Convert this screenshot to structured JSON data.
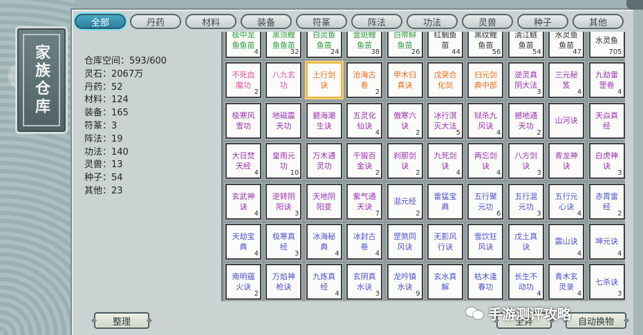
{
  "window": {
    "title": "家族仓库"
  },
  "tabs": [
    "全部",
    "丹药",
    "材料",
    "装备",
    "符篆",
    "阵法",
    "功法",
    "灵兽",
    "种子",
    "其他"
  ],
  "stats": [
    "仓库空间：593/600",
    "灵石：2067万",
    "丹药：52",
    "材料：124",
    "装备：165",
    "符篆：3",
    "阵法：19",
    "功法：140",
    "灵兽：13",
    "种子：54",
    "其他：23"
  ],
  "grid": {
    "rows": [
      [
        {
          "name": "极中龙鱼鱼苗",
          "count": "4",
          "quality": "green"
        },
        {
          "name": "黑须鲤鱼鱼苗",
          "count": "32",
          "quality": "green"
        },
        {
          "name": "白灵鱼鱼苗",
          "count": "24",
          "quality": "green"
        },
        {
          "name": "金斑鲤鱼苗",
          "count": "38",
          "quality": "green"
        },
        {
          "name": "白带鲟鱼苗",
          "count": "26",
          "quality": "green"
        },
        {
          "name": "红鲷鱼苗",
          "count": "44",
          "quality": "black"
        },
        {
          "name": "黑纹鲤鱼苗",
          "count": "56",
          "quality": "black"
        },
        {
          "name": "清江鲢鱼苗",
          "count": "54",
          "quality": "black"
        },
        {
          "name": "水灵鱼鱼苗",
          "count": "47",
          "quality": "black"
        },
        {
          "name": "水灵鱼",
          "count": "705",
          "quality": "black"
        }
      ],
      [
        {
          "name": "不死血魔功",
          "count": "2",
          "quality": "pink"
        },
        {
          "name": "八九玄功",
          "count": "",
          "quality": "pink"
        },
        {
          "name": "土行剑诀",
          "count": "",
          "quality": "orange"
        },
        {
          "name": "沧海古卷",
          "count": "2",
          "quality": "orange"
        },
        {
          "name": "甲木归真诀",
          "count": "",
          "quality": "orange"
        },
        {
          "name": "戊癸合化剑",
          "count": "",
          "quality": "orange"
        },
        {
          "name": "归元剑典中部",
          "count": "",
          "quality": "orange"
        },
        {
          "name": "逆灵真阴大法",
          "count": "3",
          "quality": "purple"
        },
        {
          "name": "三元秘笈",
          "count": "4",
          "quality": "purple"
        },
        {
          "name": "九劫雷罡卷",
          "count": "4",
          "quality": "purple"
        }
      ],
      [
        {
          "name": "极寒风雪功",
          "count": "",
          "quality": "purple"
        },
        {
          "name": "地磁震天功",
          "count": "",
          "quality": "purple"
        },
        {
          "name": "碧海潮生诀",
          "count": "",
          "quality": "purple"
        },
        {
          "name": "五灵化仙诀",
          "count": "4",
          "quality": "purple"
        },
        {
          "name": "傲寒六诀",
          "count": "2",
          "quality": "purple"
        },
        {
          "name": "冰行溟灭大法",
          "count": "5",
          "quality": "purple"
        },
        {
          "name": "狱杀九风诀",
          "count": "4",
          "quality": "purple"
        },
        {
          "name": "撼地通天功",
          "count": "2",
          "quality": "purple"
        },
        {
          "name": "山河诀",
          "count": "",
          "quality": "purple"
        },
        {
          "name": "天焱真经",
          "count": "",
          "quality": "purple"
        }
      ],
      [
        {
          "name": "大日焚天经",
          "count": "4",
          "quality": "purple"
        },
        {
          "name": "皇雨元功",
          "count": "10",
          "quality": "purple"
        },
        {
          "name": "万木通灵功",
          "count": "",
          "quality": "purple"
        },
        {
          "name": "千锻百金诀",
          "count": "2",
          "quality": "purple"
        },
        {
          "name": "刹那剑诀",
          "count": "2",
          "quality": "purple"
        },
        {
          "name": "九死剑诀",
          "count": "4",
          "quality": "purple"
        },
        {
          "name": "两忘剑诀",
          "count": "4",
          "quality": "purple"
        },
        {
          "name": "八方剑诀",
          "count": "3",
          "quality": "purple"
        },
        {
          "name": "青龙神诀",
          "count": "",
          "quality": "purple"
        },
        {
          "name": "白虎神诀",
          "count": "3",
          "quality": "purple"
        }
      ],
      [
        {
          "name": "玄武神诀",
          "count": "4",
          "quality": "purple"
        },
        {
          "name": "逆转阴阳诀",
          "count": "3",
          "quality": "purple"
        },
        {
          "name": "天地阴阳变",
          "count": "",
          "quality": "purple"
        },
        {
          "name": "紫气通天诀",
          "count": "7",
          "quality": "purple"
        },
        {
          "name": "混元经",
          "count": "2",
          "quality": "blue"
        },
        {
          "name": "雷猛宝典",
          "count": "",
          "quality": "blue"
        },
        {
          "name": "五行聚元功",
          "count": "6",
          "quality": "blue"
        },
        {
          "name": "五行混元功",
          "count": "3",
          "quality": "blue"
        },
        {
          "name": "五行元心诀",
          "count": "4",
          "quality": "blue"
        },
        {
          "name": "赤霄雷经",
          "count": "2",
          "quality": "blue"
        }
      ],
      [
        {
          "name": "天劫宝典",
          "count": "4",
          "quality": "blue"
        },
        {
          "name": "极寒真经",
          "count": "3",
          "quality": "blue"
        },
        {
          "name": "冰海秘典",
          "count": "4",
          "quality": "blue"
        },
        {
          "name": "冰封古卷",
          "count": "4",
          "quality": "blue"
        },
        {
          "name": "罡煞同风诀",
          "count": "",
          "quality": "blue"
        },
        {
          "name": "无影风行诀",
          "count": "",
          "quality": "blue"
        },
        {
          "name": "雪饮狂风诀",
          "count": "",
          "quality": "blue"
        },
        {
          "name": "戊土真诀",
          "count": "",
          "quality": "blue"
        },
        {
          "name": "震山诀",
          "count": "4",
          "quality": "blue"
        },
        {
          "name": "坤元诀",
          "count": "4",
          "quality": "blue"
        }
      ],
      [
        {
          "name": "南明蕴火诀",
          "count": "2",
          "quality": "blue"
        },
        {
          "name": "万焰神枪诀",
          "count": "",
          "quality": "blue"
        },
        {
          "name": "九炼真经",
          "count": "4",
          "quality": "blue"
        },
        {
          "name": "玄阴真水诀",
          "count": "3",
          "quality": "blue"
        },
        {
          "name": "龙吟镇水诀",
          "count": "9",
          "quality": "blue"
        },
        {
          "name": "玄水真解",
          "count": "",
          "quality": "blue"
        },
        {
          "name": "枯木逢春功",
          "count": "",
          "quality": "blue"
        },
        {
          "name": "长生不动功",
          "count": "4",
          "quality": "blue"
        },
        {
          "name": "青木玄灵录",
          "count": "4",
          "quality": "blue"
        },
        {
          "name": "七杀诀",
          "count": "3",
          "quality": "blue"
        }
      ]
    ]
  },
  "buttons": {
    "sort": "整理",
    "btn2": "全弃",
    "btn3": "自动换物"
  },
  "watermark": "手游测评攻略",
  "colors": {
    "tab_active": "#2c7f9c",
    "green": "#2b9a3a",
    "blue": "#4b4fd0",
    "purple": "#9b2fb3",
    "orange": "#ea6a17",
    "pink": "#e84d9a",
    "selected_border": "#e8b43b"
  }
}
